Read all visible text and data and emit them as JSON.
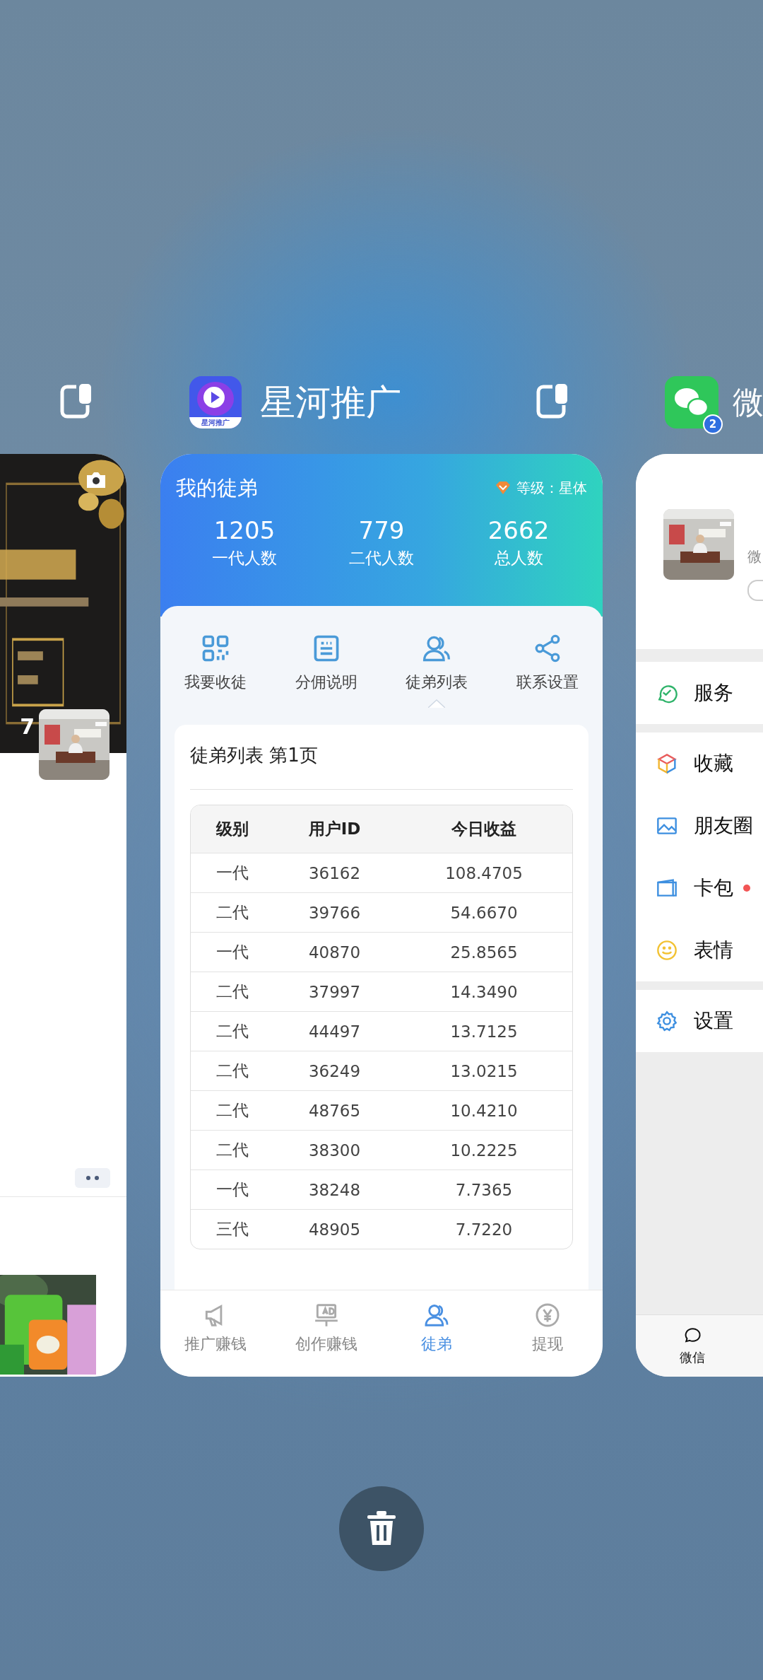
{
  "left_card": {
    "image_count": "7"
  },
  "center_app": {
    "app_name": "星河推广",
    "icon_caption": "星河推广",
    "header": {
      "title": "我的徒弟",
      "level": "等级：星体"
    },
    "stats": [
      {
        "value": "1205",
        "label": "一代人数"
      },
      {
        "value": "779",
        "label": "二代人数"
      },
      {
        "value": "2662",
        "label": "总人数"
      }
    ],
    "menu": [
      {
        "label": "我要收徒",
        "kind": "qr",
        "selected": false
      },
      {
        "label": "分佣说明",
        "kind": "doc",
        "selected": false
      },
      {
        "label": "徒弟列表",
        "kind": "people",
        "selected": true
      },
      {
        "label": "联系设置",
        "kind": "share",
        "selected": false
      }
    ],
    "list_title": "徒弟列表 第1页",
    "table": {
      "columns": [
        "级别",
        "用户ID",
        "今日收益"
      ],
      "rows": [
        [
          "一代",
          "36162",
          "108.4705"
        ],
        [
          "二代",
          "39766",
          "54.6670"
        ],
        [
          "一代",
          "40870",
          "25.8565"
        ],
        [
          "二代",
          "37997",
          "14.3490"
        ],
        [
          "二代",
          "44497",
          "13.7125"
        ],
        [
          "二代",
          "36249",
          "13.0215"
        ],
        [
          "二代",
          "48765",
          "10.4210"
        ],
        [
          "二代",
          "38300",
          "10.2225"
        ],
        [
          "一代",
          "38248",
          "7.7365"
        ],
        [
          "三代",
          "48905",
          "7.7220"
        ]
      ]
    },
    "tabs": [
      {
        "label": "推广赚钱",
        "kind": "megaphone",
        "selected": false
      },
      {
        "label": "创作赚钱",
        "kind": "ad",
        "selected": false
      },
      {
        "label": "徒弟",
        "kind": "people",
        "selected": true
      },
      {
        "label": "提现",
        "kind": "yuan",
        "selected": false
      }
    ]
  },
  "right_app": {
    "app_name": "微",
    "badge": "2",
    "profile": {
      "subtitle": "微"
    },
    "groups": [
      [
        {
          "label": "服务",
          "kind": "service",
          "dot": false
        }
      ],
      [
        {
          "label": "收藏",
          "kind": "favorites",
          "dot": false
        },
        {
          "label": "朋友圈",
          "kind": "moments",
          "dot": false
        },
        {
          "label": "卡包",
          "kind": "cards",
          "dot": true
        },
        {
          "label": "表情",
          "kind": "stickers",
          "dot": false
        }
      ],
      [
        {
          "label": "设置",
          "kind": "settings",
          "dot": false
        }
      ]
    ],
    "tabs": [
      {
        "label": "微信",
        "kind": "chats",
        "selected": false
      }
    ]
  }
}
